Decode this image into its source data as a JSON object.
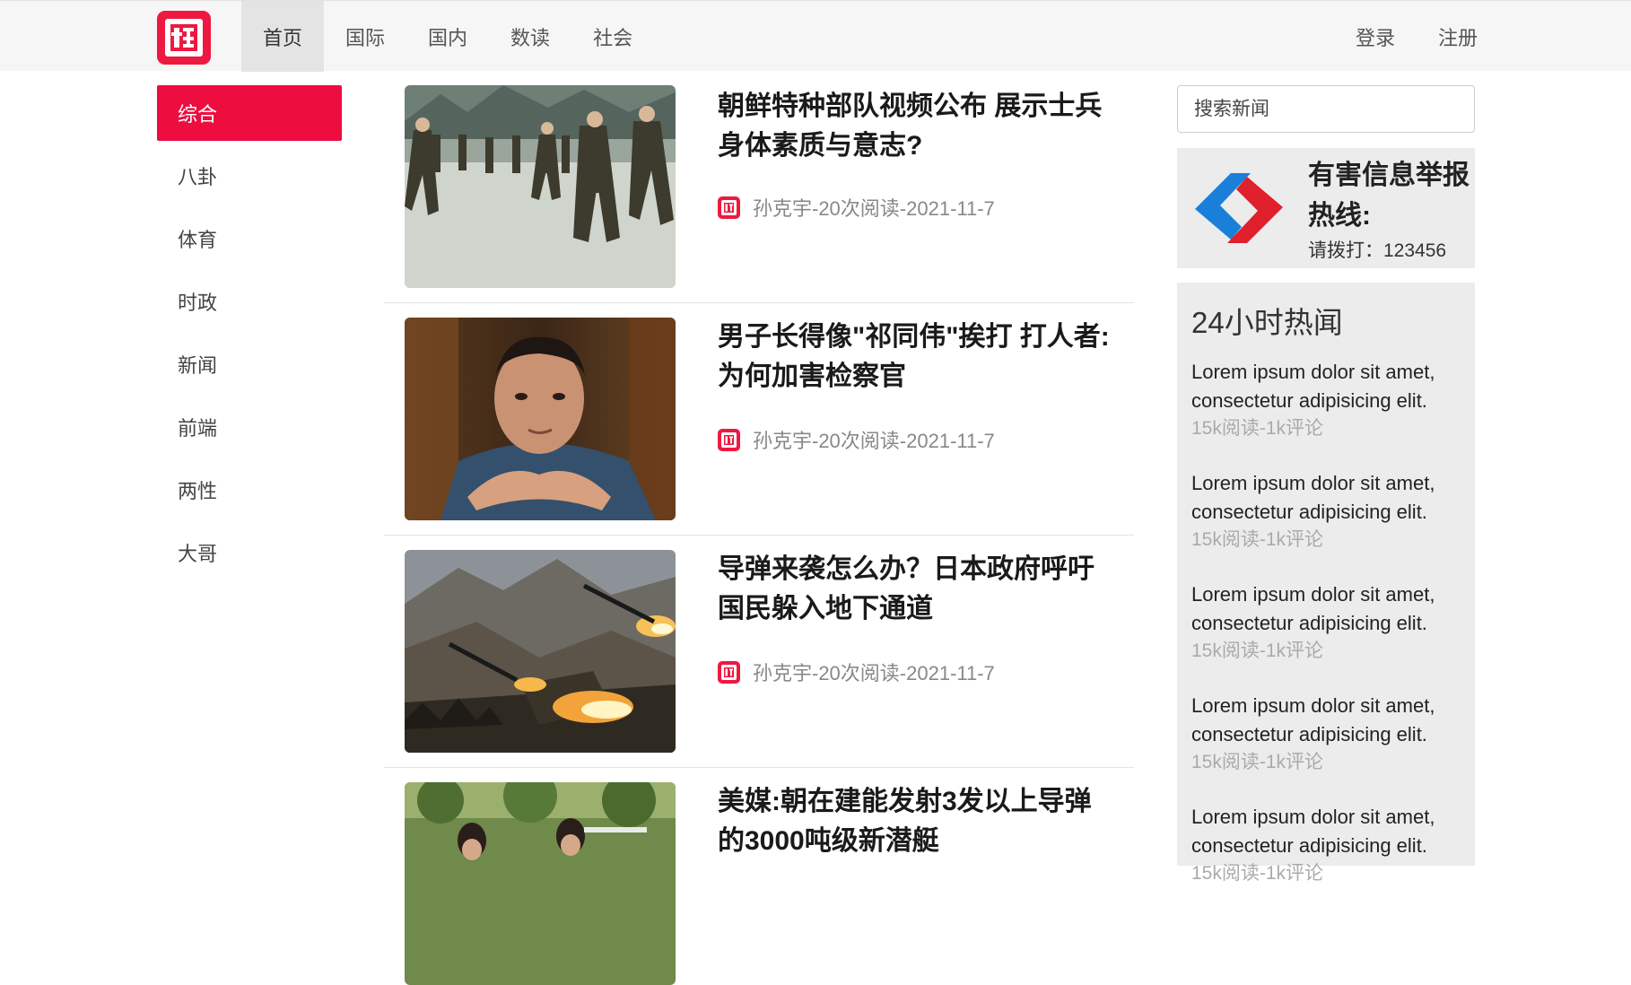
{
  "header": {
    "logo_icon": "gua-logo-icon",
    "nav": [
      {
        "label": "首页",
        "active": true
      },
      {
        "label": "国际",
        "active": false
      },
      {
        "label": "国内",
        "active": false
      },
      {
        "label": "数读",
        "active": false
      },
      {
        "label": "社会",
        "active": false
      }
    ],
    "auth": {
      "login": "登录",
      "register": "注册"
    }
  },
  "sidebar": {
    "items": [
      {
        "label": "综合",
        "active": true
      },
      {
        "label": "八卦",
        "active": false
      },
      {
        "label": "体育",
        "active": false
      },
      {
        "label": "时政",
        "active": false
      },
      {
        "label": "新闻",
        "active": false
      },
      {
        "label": "前端",
        "active": false
      },
      {
        "label": "两性",
        "active": false
      },
      {
        "label": "大哥",
        "active": false
      }
    ]
  },
  "news": [
    {
      "title": "朝鲜特种部队视频公布 展示士兵身体素质与意志?",
      "meta": "孙克宇-20次阅读-2021-11-7",
      "image": "soldiers-training-photo"
    },
    {
      "title": "男子长得像\"祁同伟\"挨打 打人者:为何加害检察官",
      "meta": "孙克宇-20次阅读-2021-11-7",
      "image": "man-portrait-photo"
    },
    {
      "title": "导弹来袭怎么办？日本政府呼吁国民躲入地下通道",
      "meta": "孙克宇-20次阅读-2021-11-7",
      "image": "missile-launch-photo"
    },
    {
      "title": "美媒:朝在建能发射3发以上导弹的3000吨级新潜艇",
      "meta": "",
      "image": "people-outdoor-photo"
    }
  ],
  "right": {
    "search_placeholder": "搜索新闻",
    "report": {
      "title": "有害信息举报热线:",
      "phone": "请拨打：123456",
      "icon": "report-logo-icon"
    },
    "hot": {
      "title": "24小时热闻",
      "items": [
        {
          "text": "Lorem ipsum dolor sit amet, consectetur adipisicing elit.",
          "meta": "15k阅读-1k评论"
        },
        {
          "text": "Lorem ipsum dolor sit amet, consectetur adipisicing elit.",
          "meta": "15k阅读-1k评论"
        },
        {
          "text": "Lorem ipsum dolor sit amet, consectetur adipisicing elit.",
          "meta": "15k阅读-1k评论"
        },
        {
          "text": "Lorem ipsum dolor sit amet, consectetur adipisicing elit.",
          "meta": "15k阅读-1k评论"
        },
        {
          "text": "Lorem ipsum dolor sit amet, consectetur adipisicing elit.",
          "meta": "15k阅读-1k评论"
        }
      ]
    }
  },
  "colors": {
    "brand_red": "#ed1941",
    "header_bg": "#f6f6f6",
    "panel_bg": "#ececec"
  }
}
